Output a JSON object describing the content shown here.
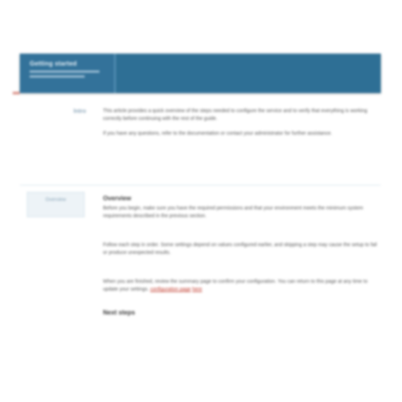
{
  "banner": {
    "title": "Getting started"
  },
  "sections": {
    "intro": {
      "side_label": "Intro",
      "paragraphs": [
        "This article provides a quick overview of the steps needed to configure the service and to verify that everything is working correctly before continuing with the rest of the guide.",
        "If you have any questions, refer to the documentation or contact your administrator for further assistance."
      ]
    },
    "details": {
      "side_label": "Overview",
      "heading": "Overview",
      "paragraphs": [
        "Before you begin, make sure you have the required permissions and that your environment meets the minimum system requirements described in the previous section.",
        "Follow each step in order. Some settings depend on values configured earlier, and skipping a step may cause the setup to fail or produce unexpected results.",
        "When you are finished, review the summary page to confirm your configuration. You can return to this page at any time to update your settings."
      ],
      "link_text": "configuration page",
      "link_text_2": "here",
      "heading_2": "Next steps"
    }
  }
}
